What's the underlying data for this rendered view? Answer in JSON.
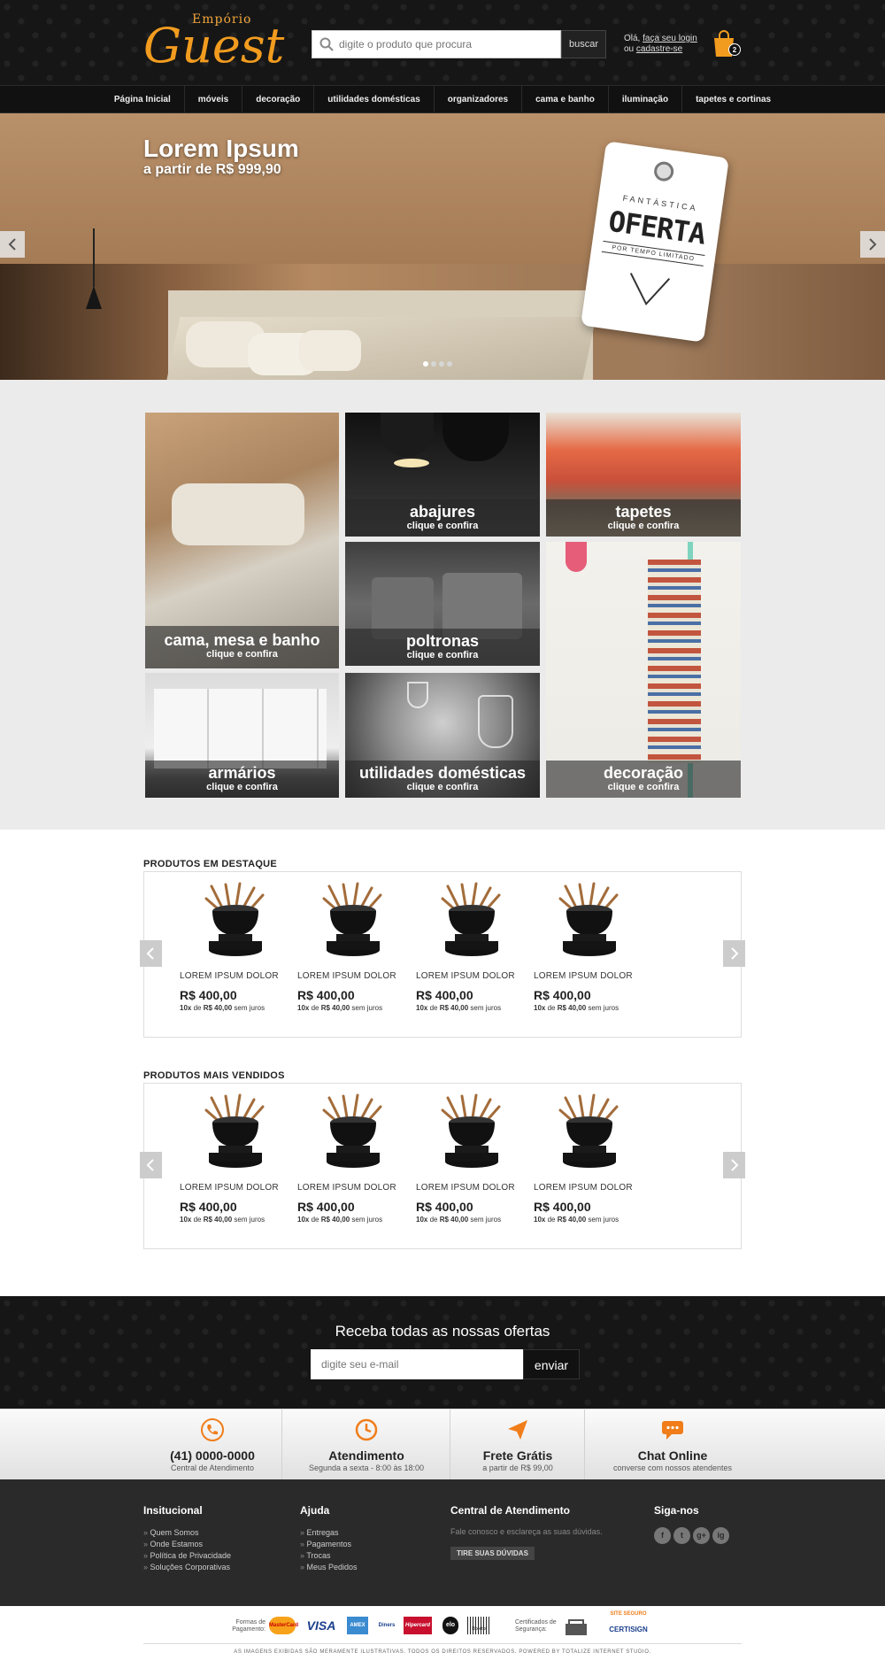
{
  "header": {
    "logo_small": "Empório",
    "logo_big": "Guest",
    "search_placeholder": "digite o produto que procura",
    "search_button": "buscar",
    "login_line1_prefix": "Olá, ",
    "login_link": "faça seu login",
    "login_line2_prefix": "ou ",
    "signup_link": "cadastre-se",
    "cart_count": "2"
  },
  "nav": [
    "Página Inicial",
    "móveis",
    "decoração",
    "utilidades domésticas",
    "organizadores",
    "cama e banho",
    "iluminação",
    "tapetes e cortinas"
  ],
  "hero": {
    "title": "Lorem Ipsum",
    "subtitle": "a partir de R$ 999,90",
    "tag_top": "FANTÁSTICA",
    "tag_main": "OFERTA",
    "tag_bottom": "POR TEMPO LIMITADO",
    "slides": 4,
    "active_slide": 1
  },
  "categories": [
    {
      "title": "cama, mesa e banho",
      "cta": "clique e confira"
    },
    {
      "title": "abajures",
      "cta": "clique e confira"
    },
    {
      "title": "tapetes",
      "cta": "clique e confira"
    },
    {
      "title": "poltronas",
      "cta": "clique e confira"
    },
    {
      "title": "decoração",
      "cta": "clique e confira"
    },
    {
      "title": "armários",
      "cta": "clique e confira"
    },
    {
      "title": "utilidades domésticas",
      "cta": "clique e confira"
    }
  ],
  "featured": {
    "title": "PRODUTOS EM DESTAQUE",
    "products": [
      {
        "name": "LOREM IPSUM DOLOR",
        "price": "R$ 400,00",
        "inst_a": "10x",
        "inst_b": " de ",
        "inst_c": "R$ 40,00",
        "inst_d": " sem juros"
      },
      {
        "name": "LOREM IPSUM DOLOR",
        "price": "R$ 400,00",
        "inst_a": "10x",
        "inst_b": " de ",
        "inst_c": "R$ 40,00",
        "inst_d": " sem juros"
      },
      {
        "name": "LOREM IPSUM DOLOR",
        "price": "R$ 400,00",
        "inst_a": "10x",
        "inst_b": " de ",
        "inst_c": "R$ 40,00",
        "inst_d": " sem juros"
      },
      {
        "name": "LOREM IPSUM DOLOR",
        "price": "R$ 400,00",
        "inst_a": "10x",
        "inst_b": " de ",
        "inst_c": "R$ 40,00",
        "inst_d": " sem juros"
      }
    ]
  },
  "bestsellers": {
    "title": "PRODUTOS MAIS VENDIDOS",
    "products": [
      {
        "name": "LOREM IPSUM DOLOR",
        "price": "R$ 400,00",
        "inst_a": "10x",
        "inst_b": " de ",
        "inst_c": "R$ 40,00",
        "inst_d": " sem juros"
      },
      {
        "name": "LOREM IPSUM DOLOR",
        "price": "R$ 400,00",
        "inst_a": "10x",
        "inst_b": " de ",
        "inst_c": "R$ 40,00",
        "inst_d": " sem juros"
      },
      {
        "name": "LOREM IPSUM DOLOR",
        "price": "R$ 400,00",
        "inst_a": "10x",
        "inst_b": " de ",
        "inst_c": "R$ 40,00",
        "inst_d": " sem juros"
      },
      {
        "name": "LOREM IPSUM DOLOR",
        "price": "R$ 400,00",
        "inst_a": "10x",
        "inst_b": " de ",
        "inst_c": "R$ 40,00",
        "inst_d": " sem juros"
      }
    ]
  },
  "newsletter": {
    "title": "Receba todas as nossas ofertas",
    "placeholder": "digite seu e-mail",
    "button": "enviar"
  },
  "features": [
    {
      "icon": "phone-icon",
      "title": "(41) 0000-0000",
      "sub": "Central de Atendimento"
    },
    {
      "icon": "clock-icon",
      "title": "Atendimento",
      "sub": "Segunda a sexta - 8:00 às 18:00"
    },
    {
      "icon": "paper-plane-icon",
      "title": "Frete Grátis",
      "sub": "a partir de R$ 99,00"
    },
    {
      "icon": "chat-icon",
      "title": "Chat Online",
      "sub": "converse com nossos atendentes"
    }
  ],
  "accent_color": "#f07d1a",
  "footer": {
    "inst_title": "Insitucional",
    "inst_items": [
      "Quem Somos",
      "Onde Estamos",
      "Política de Privacidade",
      "Soluções Corporativas"
    ],
    "help_title": "Ajuda",
    "help_items": [
      "Entregas",
      "Pagamentos",
      "Trocas",
      "Meus Pedidos"
    ],
    "central_title": "Central de Atendimento",
    "central_text": "Fale conosco e esclareça as suas dúvidas.",
    "central_button": "TIRE SUAS DÚVIDAS",
    "social_title": "Siga-nos",
    "social": [
      "f",
      "t",
      "g+",
      "ig"
    ]
  },
  "bottom": {
    "pay_label": "Formas de Pagamento:",
    "payments": [
      "MasterCard",
      "VISA",
      "AMEX",
      "Diners",
      "Hipercard",
      "elo",
      "Boleto"
    ],
    "cert_label": "Certificados de Segurança:",
    "cert_badge_top": "SITE SEGURO",
    "cert_badge": "CERTISIGN",
    "copyright": "AS IMAGENS EXIBIDAS SÃO MERAMENTE ILUSTRATIVAS. TODOS OS DIREITOS RESERVADOS. POWERED BY TOTALIZE INTERNET STUDIO."
  }
}
